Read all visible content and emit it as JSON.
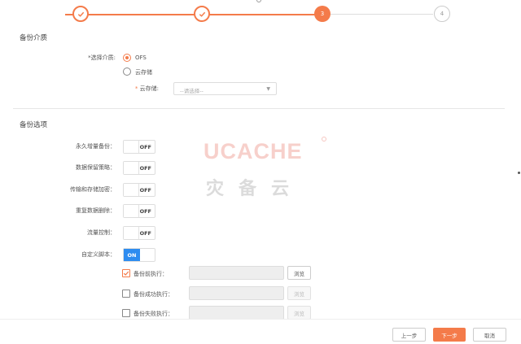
{
  "stepper": {
    "steps": [
      {
        "state": "done",
        "label": ""
      },
      {
        "state": "done",
        "label": ""
      },
      {
        "state": "active",
        "label": "3"
      },
      {
        "state": "todo",
        "label": "4"
      }
    ],
    "accent_color": "#f47b4a"
  },
  "medium_section": {
    "title": "备份介质",
    "medium_label": "*选择介质:",
    "options": [
      {
        "label": "OFS",
        "selected": true
      },
      {
        "label": "云存储",
        "selected": false
      }
    ],
    "cloud_label": "云存储:",
    "cloud_select": {
      "placeholder": "--请选择--"
    }
  },
  "options_section": {
    "title": "备份选项",
    "toggles": [
      {
        "label": "永久增量备份：",
        "state": "OFF"
      },
      {
        "label": "数据保留策略：",
        "state": "OFF"
      },
      {
        "label": "传输和存储加密：",
        "state": "OFF"
      },
      {
        "label": "重复数据删除：",
        "state": "OFF"
      },
      {
        "label": "流量控制：",
        "state": "OFF"
      },
      {
        "label": "自定义脚本：",
        "state": "ON"
      }
    ],
    "scripts": [
      {
        "label": "备份前执行：",
        "checked": true,
        "browse": "浏览",
        "enabled": true
      },
      {
        "label": "备份成功执行：",
        "checked": false,
        "browse": "浏览",
        "enabled": false
      },
      {
        "label": "备份失败执行：",
        "checked": false,
        "browse": "浏览",
        "enabled": false
      }
    ]
  },
  "watermark": {
    "brand": "UCACHE",
    "subtitle": "灾备云"
  },
  "footer": {
    "prev": "上一步",
    "next": "下一步",
    "cancel": "取消"
  }
}
